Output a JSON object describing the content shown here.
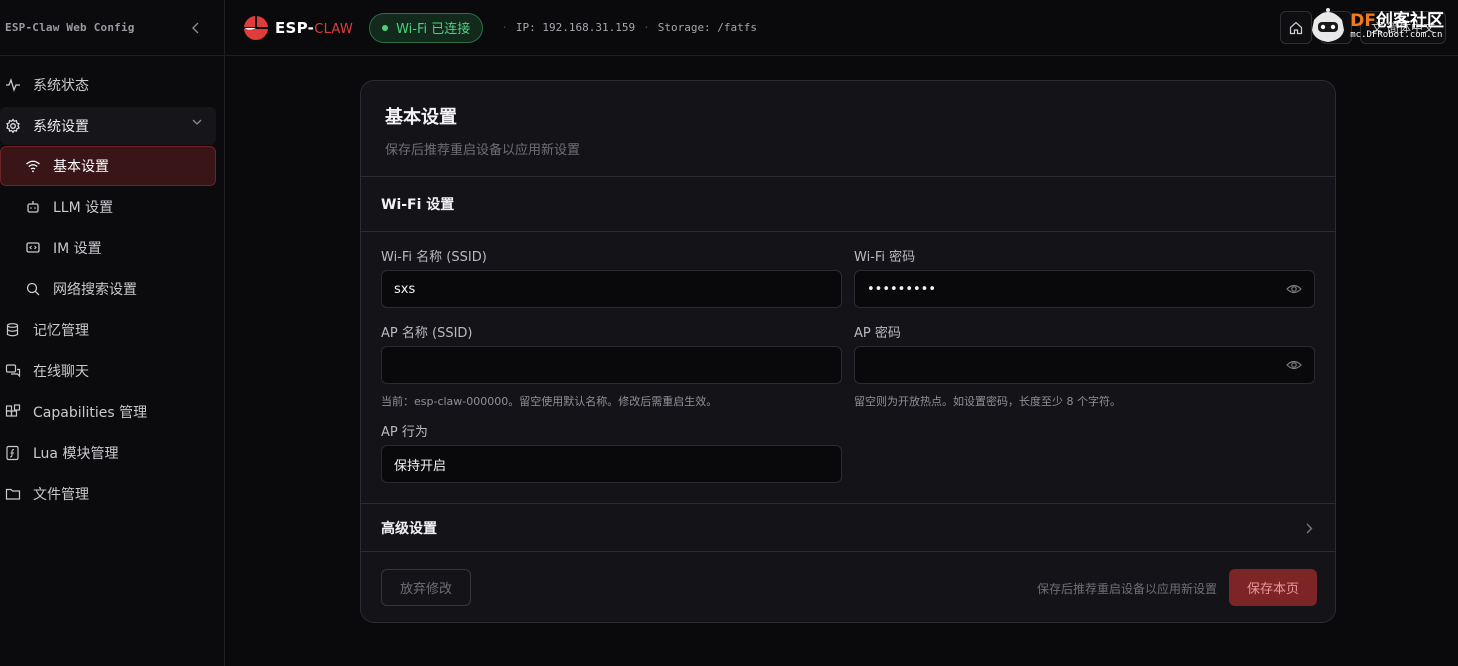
{
  "sidebar": {
    "brand": "ESP-Claw Web Config",
    "items": [
      {
        "label": "系统状态"
      },
      {
        "label": "系统设置"
      },
      {
        "label": "基本设置"
      },
      {
        "label": "LLM 设置"
      },
      {
        "label": "IM 设置"
      },
      {
        "label": "网络搜索设置"
      },
      {
        "label": "记忆管理"
      },
      {
        "label": "在线聊天"
      },
      {
        "label": "Capabilities 管理"
      },
      {
        "label": "Lua 模块管理"
      },
      {
        "label": "文件管理"
      }
    ]
  },
  "topbar": {
    "logo_main": "ESP-",
    "logo_sub": "CLAW",
    "wifi_status": "Wi-Fi 已连接",
    "ip": "IP: 192.168.31.159",
    "storage": "Storage: /fatfs",
    "lang_label": "文 简体中文"
  },
  "watermark": {
    "title_df": "DF",
    "title_rest": "创客社区",
    "url": "mc.DFRobot.com.cn"
  },
  "card": {
    "title": "基本设置",
    "subtitle": "保存后推荐重启设备以应用新设置",
    "wifi_section": "Wi-Fi 设置",
    "fields": {
      "ssid_label": "Wi-Fi 名称 (SSID)",
      "ssid_value": "sxs",
      "password_label": "Wi-Fi 密码",
      "password_value": "•••••••••",
      "ap_name_label": "AP 名称 (SSID)",
      "ap_name_value": "",
      "ap_name_hint": "当前：esp-claw-000000。留空使用默认名称。修改后需重启生效。",
      "ap_password_label": "AP 密码",
      "ap_password_value": "",
      "ap_password_hint": "留空则为开放热点。如设置密码，长度至少 8 个字符。",
      "ap_behavior_label": "AP 行为",
      "ap_behavior_value": "保持开启"
    },
    "advanced_section": "高级设置",
    "footer": {
      "discard": "放弃修改",
      "hint": "保存后推荐重启设备以应用新设置",
      "save": "保存本页"
    }
  },
  "colors": {
    "accent": "#e03c3c",
    "active_bg": "#3a1518",
    "success": "#4fd07e",
    "save_bg": "#7d2427"
  }
}
